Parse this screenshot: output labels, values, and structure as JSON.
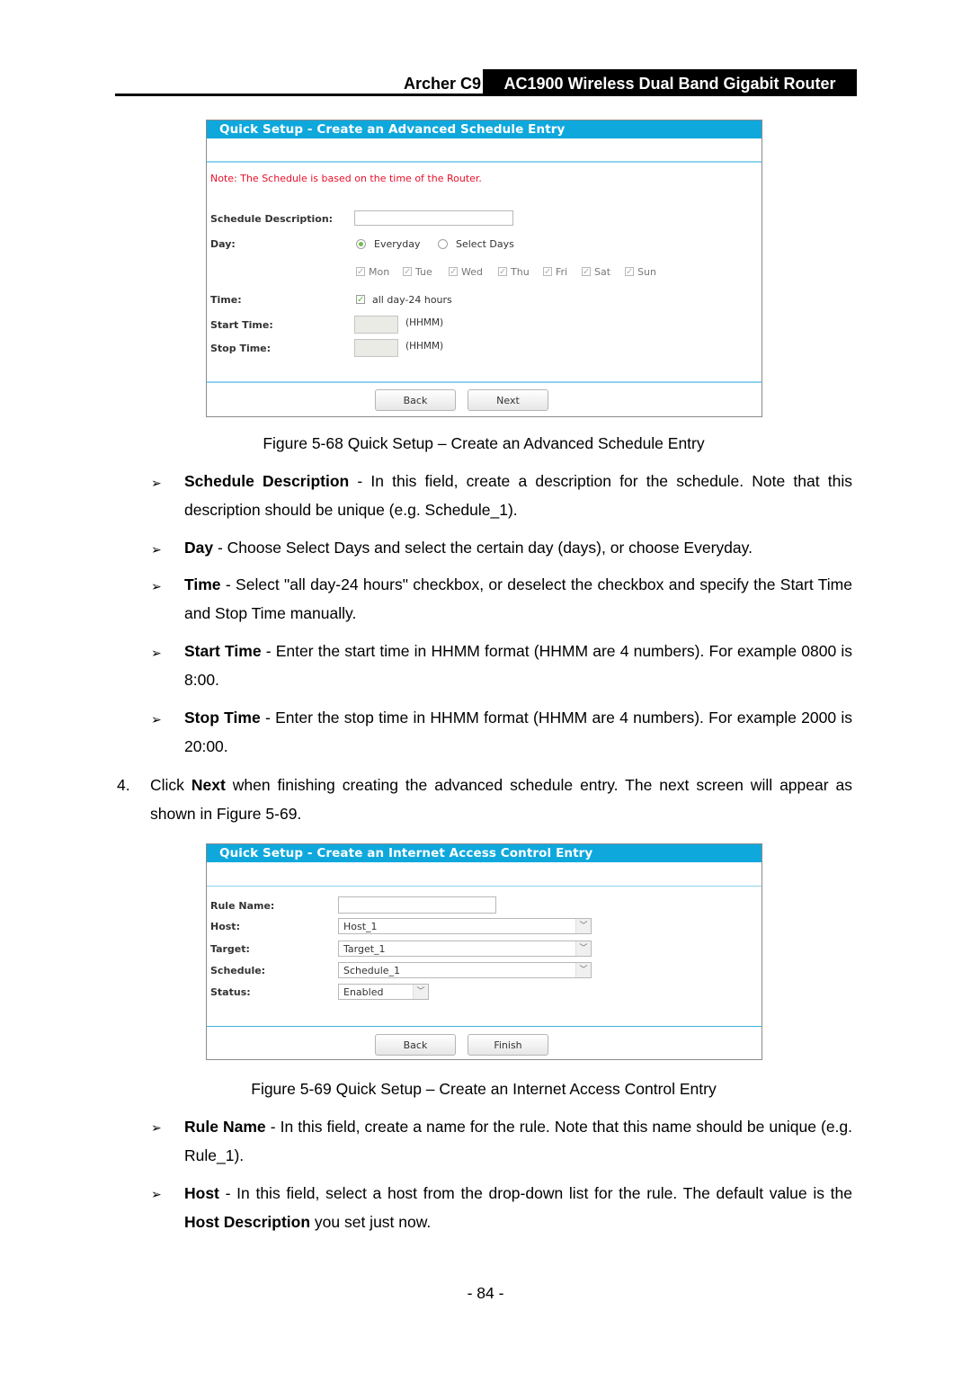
{
  "header": {
    "model": "Archer C9",
    "product": "AC1900 Wireless Dual Band Gigabit Router"
  },
  "figure68": {
    "title": "Quick Setup - Create an Advanced Schedule Entry",
    "note": "Note: The Schedule is based on the time of the Router.",
    "schedule_description_label": "Schedule Description:",
    "schedule_description_value": "",
    "day_label": "Day:",
    "day_options": [
      {
        "label": "Everyday",
        "selected": true
      },
      {
        "label": "Select Days",
        "selected": false
      }
    ],
    "days": [
      {
        "label": "Mon",
        "checked": true
      },
      {
        "label": "Tue",
        "checked": true
      },
      {
        "label": "Wed",
        "checked": true
      },
      {
        "label": "Thu",
        "checked": true
      },
      {
        "label": "Fri",
        "checked": true
      },
      {
        "label": "Sat",
        "checked": true
      },
      {
        "label": "Sun",
        "checked": true
      }
    ],
    "time_label": "Time:",
    "all_day_label": "all day-24 hours",
    "all_day_checked": true,
    "start_time_label": "Start Time:",
    "stop_time_label": "Stop Time:",
    "hhmm_hint": "(HHMM)",
    "back_button": "Back",
    "next_button": "Next",
    "caption": "Figure 5-68 Quick Setup – Create an Advanced Schedule Entry"
  },
  "bullets1": [
    {
      "term": "Schedule Description",
      "text": " - In this field, create a description for the schedule. Note that this description should be unique (e.g. Schedule_1)."
    },
    {
      "term": "Day",
      "text": " - Choose Select Days and select the certain day (days), or choose Everyday."
    },
    {
      "term": "Time",
      "text": " - Select \"all day-24 hours\" checkbox, or deselect the checkbox and specify the Start Time and Stop Time manually."
    },
    {
      "term": "Start Time",
      "text": " - Enter the start time in HHMM format (HHMM are 4 numbers). For example 0800 is 8:00."
    },
    {
      "term": "Stop Time",
      "text": " - Enter the stop time in HHMM format (HHMM are 4 numbers). For example 2000 is 20:00."
    }
  ],
  "step4": {
    "number": "4.",
    "pre": "Click ",
    "bold": "Next",
    "post": " when finishing creating the advanced schedule entry. The next screen will appear as shown in Figure 5-69."
  },
  "figure69": {
    "title": "Quick Setup - Create an Internet Access Control Entry",
    "rule_name_label": "Rule Name:",
    "rule_name_value": "",
    "host_label": "Host:",
    "host_value": "Host_1",
    "target_label": "Target:",
    "target_value": "Target_1",
    "schedule_label": "Schedule:",
    "schedule_value": "Schedule_1",
    "status_label": "Status:",
    "status_value": "Enabled",
    "back_button": "Back",
    "finish_button": "Finish",
    "caption": "Figure 5-69 Quick Setup – Create an Internet Access Control Entry"
  },
  "bullets2": [
    {
      "term": "Rule Name",
      "text": " - In this field, create a name for the rule. Note that this name should be unique (e.g. Rule_1)."
    },
    {
      "term": "Host",
      "text": " - In this field, select a host from the drop-down list for the rule. The default value is the ",
      "term2": "Host Description",
      "text2": " you set just now."
    }
  ],
  "bullet_glyph": "➢",
  "page_number": "- 84 -"
}
